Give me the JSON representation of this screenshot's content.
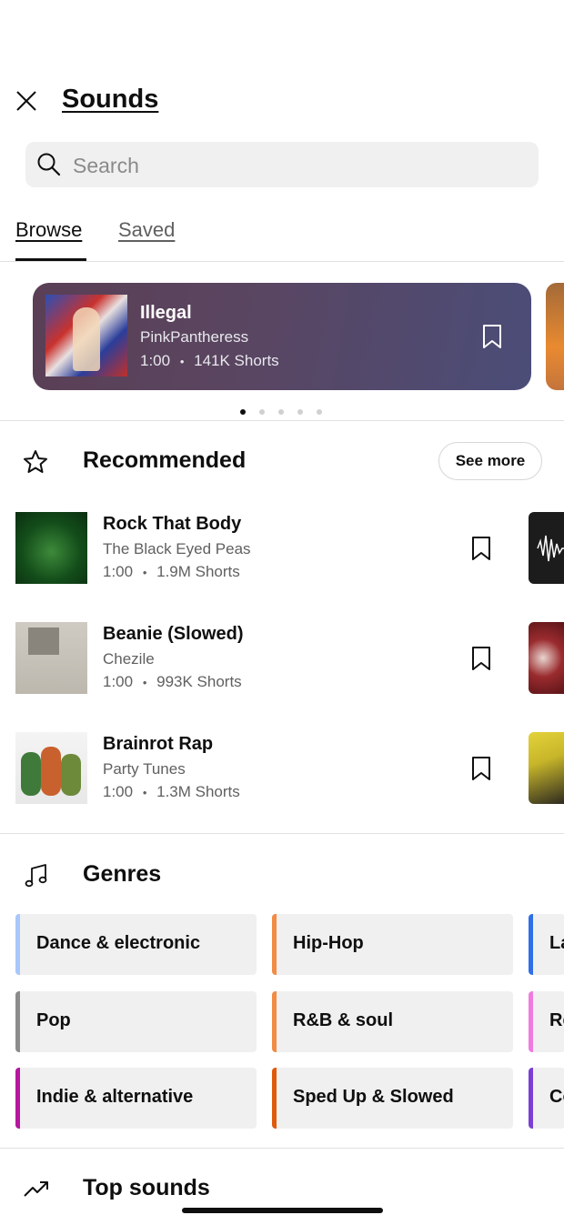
{
  "header": {
    "title": "Sounds"
  },
  "search": {
    "placeholder": "Search"
  },
  "tabs": [
    {
      "label": "Browse"
    },
    {
      "label": "Saved"
    }
  ],
  "featured": {
    "title": "Illegal",
    "artist": "PinkPantheress",
    "duration": "1:00",
    "shorts": "141K Shorts",
    "carousel_pages": 5,
    "active_page": 1
  },
  "recommended": {
    "title": "Recommended",
    "see_more": "See more",
    "items": [
      {
        "title": "Rock That Body",
        "artist": "The Black Eyed Peas",
        "duration": "1:00",
        "shorts": "1.9M Shorts"
      },
      {
        "title": "Beanie (Slowed)",
        "artist": "Chezile",
        "duration": "1:00",
        "shorts": "993K Shorts"
      },
      {
        "title": "Brainrot Rap",
        "artist": "Party Tunes",
        "duration": "1:00",
        "shorts": "1.3M Shorts"
      }
    ]
  },
  "genres": {
    "title": "Genres",
    "items": [
      {
        "label": "Dance & electronic",
        "color": "#a8c7fa"
      },
      {
        "label": "Hip-Hop",
        "color": "#f28b44"
      },
      {
        "label": "La",
        "color": "#2f6fe8"
      },
      {
        "label": "Pop",
        "color": "#8c8c8c"
      },
      {
        "label": "R&B & soul",
        "color": "#f28b44"
      },
      {
        "label": "Re",
        "color": "#f07be0"
      },
      {
        "label": "Indie & alternative",
        "color": "#b5179e"
      },
      {
        "label": "Sped Up & Slowed",
        "color": "#e05a0c"
      },
      {
        "label": "Co",
        "color": "#7b3fd6"
      }
    ]
  },
  "top_sounds": {
    "title": "Top sounds"
  },
  "separator": "•"
}
